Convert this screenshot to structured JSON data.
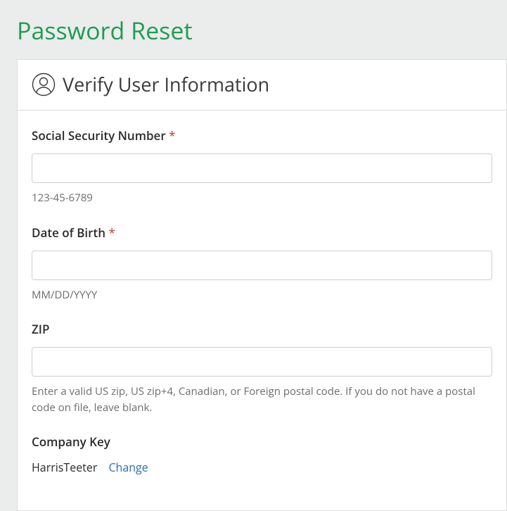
{
  "page": {
    "title": "Password Reset"
  },
  "section": {
    "heading": "Verify User Information"
  },
  "fields": {
    "ssn": {
      "label": "Social Security Number",
      "required": "*",
      "value": "",
      "hint": "123-45-6789"
    },
    "dob": {
      "label": "Date of Birth",
      "required": "*",
      "value": "",
      "hint": "MM/DD/YYYY"
    },
    "zip": {
      "label": "ZIP",
      "value": "",
      "hint": "Enter a valid US zip, US zip+4, Canadian, or Foreign postal code. If you do not have a postal code on file, leave blank."
    },
    "company": {
      "label": "Company Key",
      "value": "HarrisTeeter",
      "change_link": "Change"
    }
  }
}
